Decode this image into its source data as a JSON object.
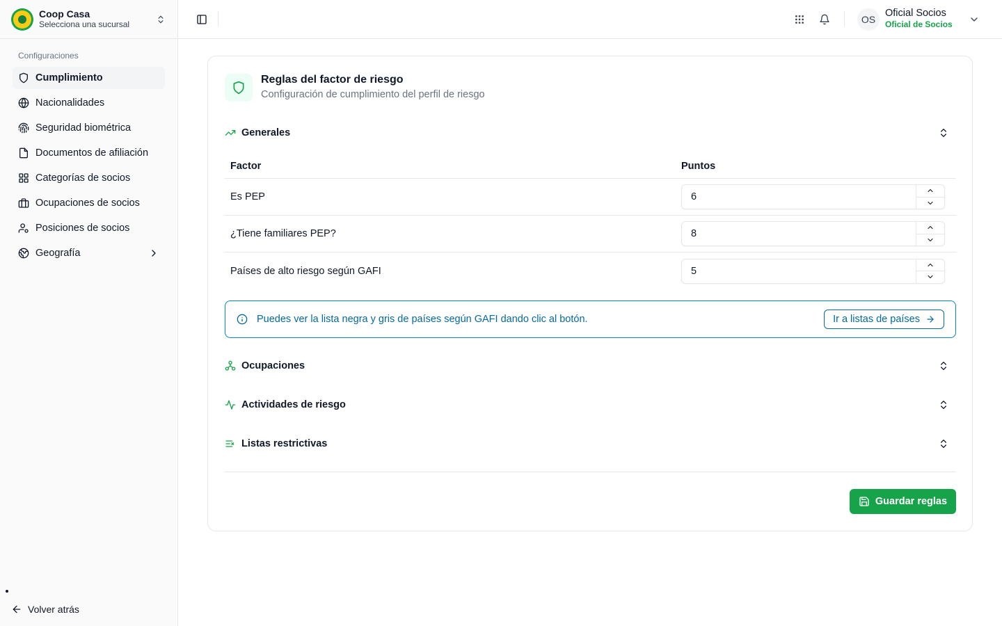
{
  "org": {
    "name": "Coop Casa",
    "branch_prompt": "Selecciona una sucursal"
  },
  "sidebar": {
    "section_label": "Configuraciones",
    "items": [
      {
        "label": "Cumplimiento",
        "icon": "shield-icon",
        "active": true
      },
      {
        "label": "Nacionalidades",
        "icon": "globe-icon"
      },
      {
        "label": "Seguridad biométrica",
        "icon": "fingerprint-icon"
      },
      {
        "label": "Documentos de afiliación",
        "icon": "file-icon"
      },
      {
        "label": "Categorías de socios",
        "icon": "grid-icon"
      },
      {
        "label": "Ocupaciones de socios",
        "icon": "briefcase-icon"
      },
      {
        "label": "Posiciones de socios",
        "icon": "user-cog-icon"
      },
      {
        "label": "Geografía",
        "icon": "earth-icon",
        "has_submenu": true
      }
    ],
    "back_label": "Volver atrás"
  },
  "user": {
    "initials": "OS",
    "name": "Oficial Socios",
    "role": "Oficial de Socios"
  },
  "card": {
    "title": "Reglas del factor de riesgo",
    "description": "Configuración de cumplimiento del perfil de riesgo"
  },
  "sections": {
    "generales": "Generales",
    "ocupaciones": "Ocupaciones",
    "actividades": "Actividades de riesgo",
    "listas": "Listas restrictivas"
  },
  "table": {
    "headers": {
      "factor": "Factor",
      "points": "Puntos"
    },
    "rows": [
      {
        "factor": "Es PEP",
        "points": "6"
      },
      {
        "factor": "¿Tiene familiares PEP?",
        "points": "8"
      },
      {
        "factor": "Países de alto riesgo según GAFI",
        "points": "5"
      }
    ]
  },
  "alert": {
    "message": "Puedes ver la lista negra y gris de países según GAFI dando clic al botón.",
    "button": "Ir a listas de países"
  },
  "actions": {
    "save": "Guardar reglas"
  },
  "colors": {
    "accent": "#16a34a",
    "info": "#0369a1"
  }
}
